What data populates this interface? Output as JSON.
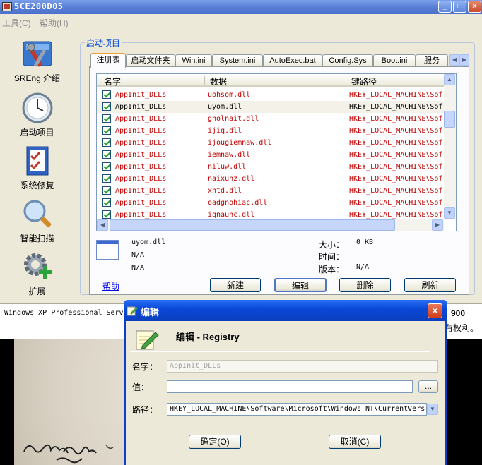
{
  "window": {
    "title": "5CE200D05",
    "minimize": "_",
    "maximize": "□",
    "close": "×"
  },
  "menu": {
    "tools": "工具(C)",
    "help": "帮助(H)"
  },
  "sidebar": [
    {
      "label": "SREng 介绍",
      "icon": "tools-icon"
    },
    {
      "label": "启动项目",
      "icon": "clock-icon"
    },
    {
      "label": "系统修复",
      "icon": "checklist-icon"
    },
    {
      "label": "智能扫描",
      "icon": "magnifier-icon"
    },
    {
      "label": "扩展",
      "icon": "gear-plus-icon"
    }
  ],
  "group_title": "启动项目",
  "tabs": [
    "注册表",
    "启动文件夹",
    "Win.ini",
    "System.ini",
    "AutoExec.bat",
    "Config.Sys",
    "Boot.ini",
    "服务"
  ],
  "active_tab": "注册表",
  "table": {
    "columns": [
      "名字",
      "数据",
      "键路径"
    ],
    "rows": [
      {
        "name": "AppInit_DLLs",
        "data": "uohsom.dll",
        "path": "HKEY_LOCAL_MACHINE\\Sof",
        "checked": true,
        "highlight": "red"
      },
      {
        "name": "AppInit_DLLs",
        "data": "uyom.dll",
        "path": "HKEY_LOCAL_MACHINE\\Sof",
        "checked": true,
        "highlight": "selected"
      },
      {
        "name": "AppInit_DLLs",
        "data": "gnolnait.dll",
        "path": "HKEY_LOCAL_MACHINE\\Sof",
        "checked": true,
        "highlight": "red"
      },
      {
        "name": "AppInit_DLLs",
        "data": "ijiq.dll",
        "path": "HKEY_LOCAL_MACHINE\\Sof",
        "checked": true,
        "highlight": "red"
      },
      {
        "name": "AppInit_DLLs",
        "data": "ijougiemnaw.dll",
        "path": "HKEY_LOCAL_MACHINE\\Sof",
        "checked": true,
        "highlight": "red"
      },
      {
        "name": "AppInit_DLLs",
        "data": "iemnaw.dll",
        "path": "HKEY_LOCAL_MACHINE\\Sof",
        "checked": true,
        "highlight": "red"
      },
      {
        "name": "AppInit_DLLs",
        "data": "niluw.dll",
        "path": "HKEY_LOCAL_MACHINE\\Sof",
        "checked": true,
        "highlight": "red"
      },
      {
        "name": "AppInit_DLLs",
        "data": "naixuhz.dll",
        "path": "HKEY_LOCAL_MACHINE\\Sof",
        "checked": true,
        "highlight": "red"
      },
      {
        "name": "AppInit_DLLs",
        "data": "xhtd.dll",
        "path": "HKEY_LOCAL_MACHINE\\Sof",
        "checked": true,
        "highlight": "red"
      },
      {
        "name": "AppInit_DLLs",
        "data": "oadgnohiac.dll",
        "path": "HKEY_LOCAL_MACHINE\\Sof",
        "checked": true,
        "highlight": "red"
      },
      {
        "name": "AppInit_DLLs",
        "data": "iqnauhc.dll",
        "path": "HKEY_LOCAL_MACHINE\\Sof",
        "checked": true,
        "highlight": "red"
      }
    ]
  },
  "detail": {
    "filename": "uyom.dll",
    "line2": "N/A",
    "line3": "N/A",
    "size_label": "大小：",
    "size_value": "0 KB",
    "time_label": "时间：",
    "time_value": "",
    "version_label": "版本：",
    "version_value": "N/A"
  },
  "help_link": "帮助",
  "buttons": {
    "new": "新建",
    "edit": "编辑",
    "delete": "删除",
    "refresh": "刷新"
  },
  "status": {
    "os": "Windows XP Professional Serv",
    "right_top": "900",
    "right_bottom": "有权利。"
  },
  "colors": {
    "title_blue": "#4a70cc",
    "malicious_red": "#c00000",
    "accent_orange": "#f0a030"
  },
  "dialog": {
    "title": "编辑",
    "heading": "编辑 - Registry",
    "name_label": "名字：",
    "name_value": "AppInit_DLLs",
    "value_label": "值：",
    "value_value": "",
    "browse": "...",
    "path_label": "路径：",
    "path_value": "HKEY_LOCAL_MACHINE\\Software\\Microsoft\\Windows NT\\CurrentVers",
    "ok": "确定(O)",
    "cancel": "取消(C)",
    "close": "×"
  }
}
